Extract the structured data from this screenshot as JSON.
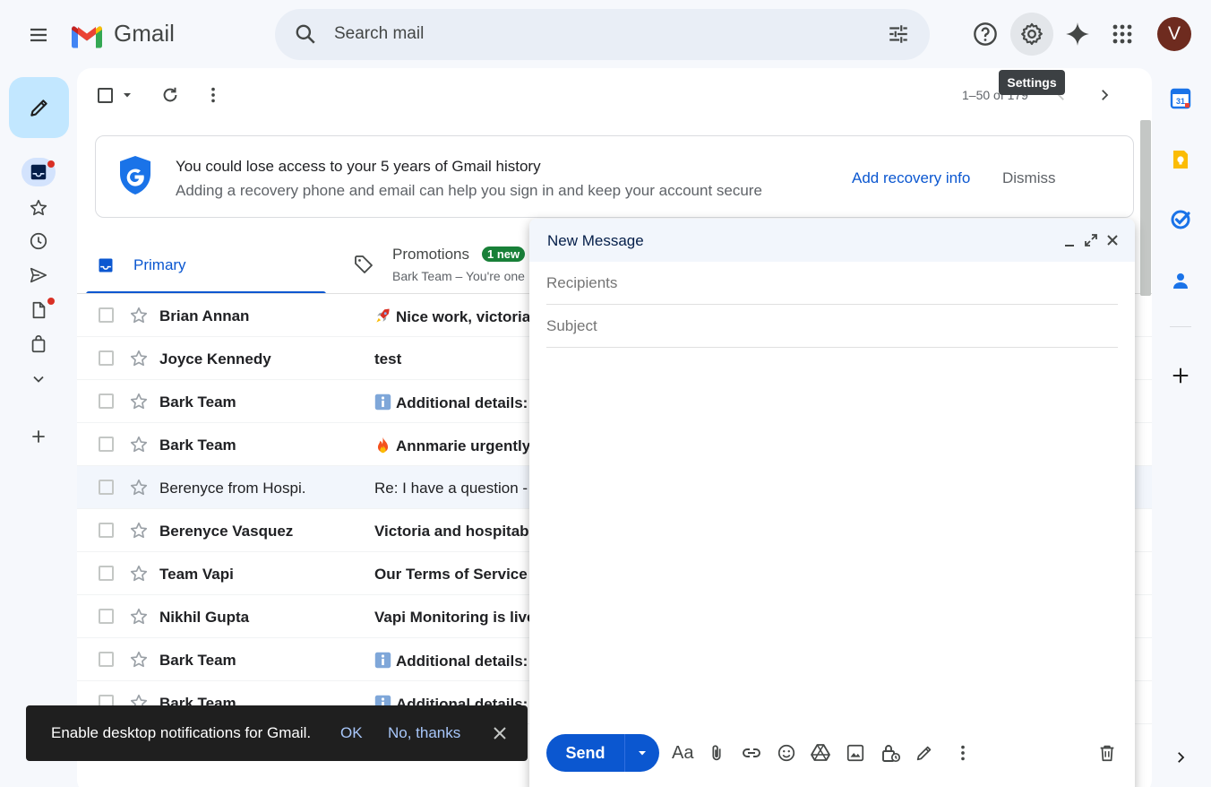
{
  "app": {
    "name": "Gmail"
  },
  "header": {
    "search_placeholder": "Search mail",
    "avatar_letter": "V",
    "tooltip": "Settings"
  },
  "toolbar": {
    "pager": "1–50 of 179"
  },
  "banner": {
    "title": "You could lose access to your 5 years of Gmail history",
    "subtitle": "Adding a recovery phone and email can help you sign in and keep your account secure",
    "action": "Add recovery info",
    "dismiss": "Dismiss"
  },
  "tabs": [
    {
      "label": "Primary"
    },
    {
      "label": "Promotions",
      "badge": "1 new",
      "snippet": "Bark Team – You're one"
    }
  ],
  "emails": [
    {
      "sender": "Brian Annan",
      "subject": "Nice work, victoria",
      "emoji": "rocket-icon",
      "read": false
    },
    {
      "sender": "Joyce Kennedy",
      "subject": "test",
      "emoji": "",
      "read": false
    },
    {
      "sender": "Bark Team",
      "subject": "Additional details:",
      "emoji": "info-icon",
      "read": false
    },
    {
      "sender": "Bark Team",
      "subject": "Annmarie urgently",
      "emoji": "fire-icon",
      "read": false
    },
    {
      "sender": "Berenyce from Hospi.",
      "subject": "Re: I have a question -",
      "emoji": "",
      "read": true
    },
    {
      "sender": "Berenyce Vasquez",
      "subject": "Victoria and hospitab",
      "emoji": "",
      "read": false
    },
    {
      "sender": "Team Vapi",
      "subject": "Our Terms of Service",
      "emoji": "",
      "read": false
    },
    {
      "sender": "Nikhil Gupta",
      "subject": "Vapi Monitoring is live",
      "emoji": "",
      "read": false
    },
    {
      "sender": "Bark Team",
      "subject": "Additional details:",
      "emoji": "info-icon",
      "read": false
    },
    {
      "sender": "Bark Team",
      "subject": "Additional details:",
      "emoji": "info-icon",
      "read": false
    }
  ],
  "compose": {
    "title": "New Message",
    "recipients_placeholder": "Recipients",
    "subject_placeholder": "Subject",
    "send_label": "Send"
  },
  "snackbar": {
    "message": "Enable desktop notifications for Gmail.",
    "ok": "OK",
    "no": "No, thanks"
  },
  "colors": {
    "accent": "#0b57d0",
    "compose_fab": "#c2e7ff",
    "badge_green": "#188038",
    "notification_dot": "#d93025"
  }
}
